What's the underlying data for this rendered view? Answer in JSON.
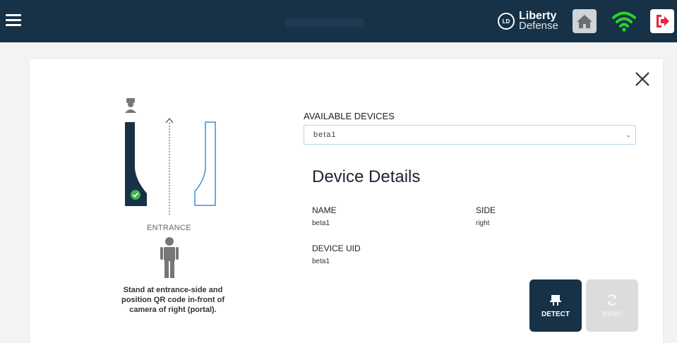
{
  "header": {
    "brand_line1": "Liberty",
    "brand_line2": "Defense",
    "logo_text": "LD",
    "accent": "#173146",
    "icons": [
      "menu-icon",
      "home-icon",
      "wifi-icon",
      "logout-icon"
    ]
  },
  "illustration": {
    "entrance_label": "ENTRANCE",
    "instructions": "Stand at entrance-side and position QR code in-front of camera of right (portal)."
  },
  "devices": {
    "label": "AVAILABLE DEVICES",
    "selected": "beta1"
  },
  "details": {
    "title": "Device Details",
    "name_label": "NAME",
    "name_value": "beta1",
    "side_label": "SIDE",
    "side_value": "right",
    "uid_label": "DEVICE UID",
    "uid_value": "beta1"
  },
  "actions": {
    "detect_label": "DETECT",
    "sync_label": "SYNC"
  },
  "colors": {
    "status_ok": "#3cb44b",
    "wifi": "#2bd12b",
    "logout": "#e8253a",
    "outline_blue": "#3a8fd8"
  }
}
